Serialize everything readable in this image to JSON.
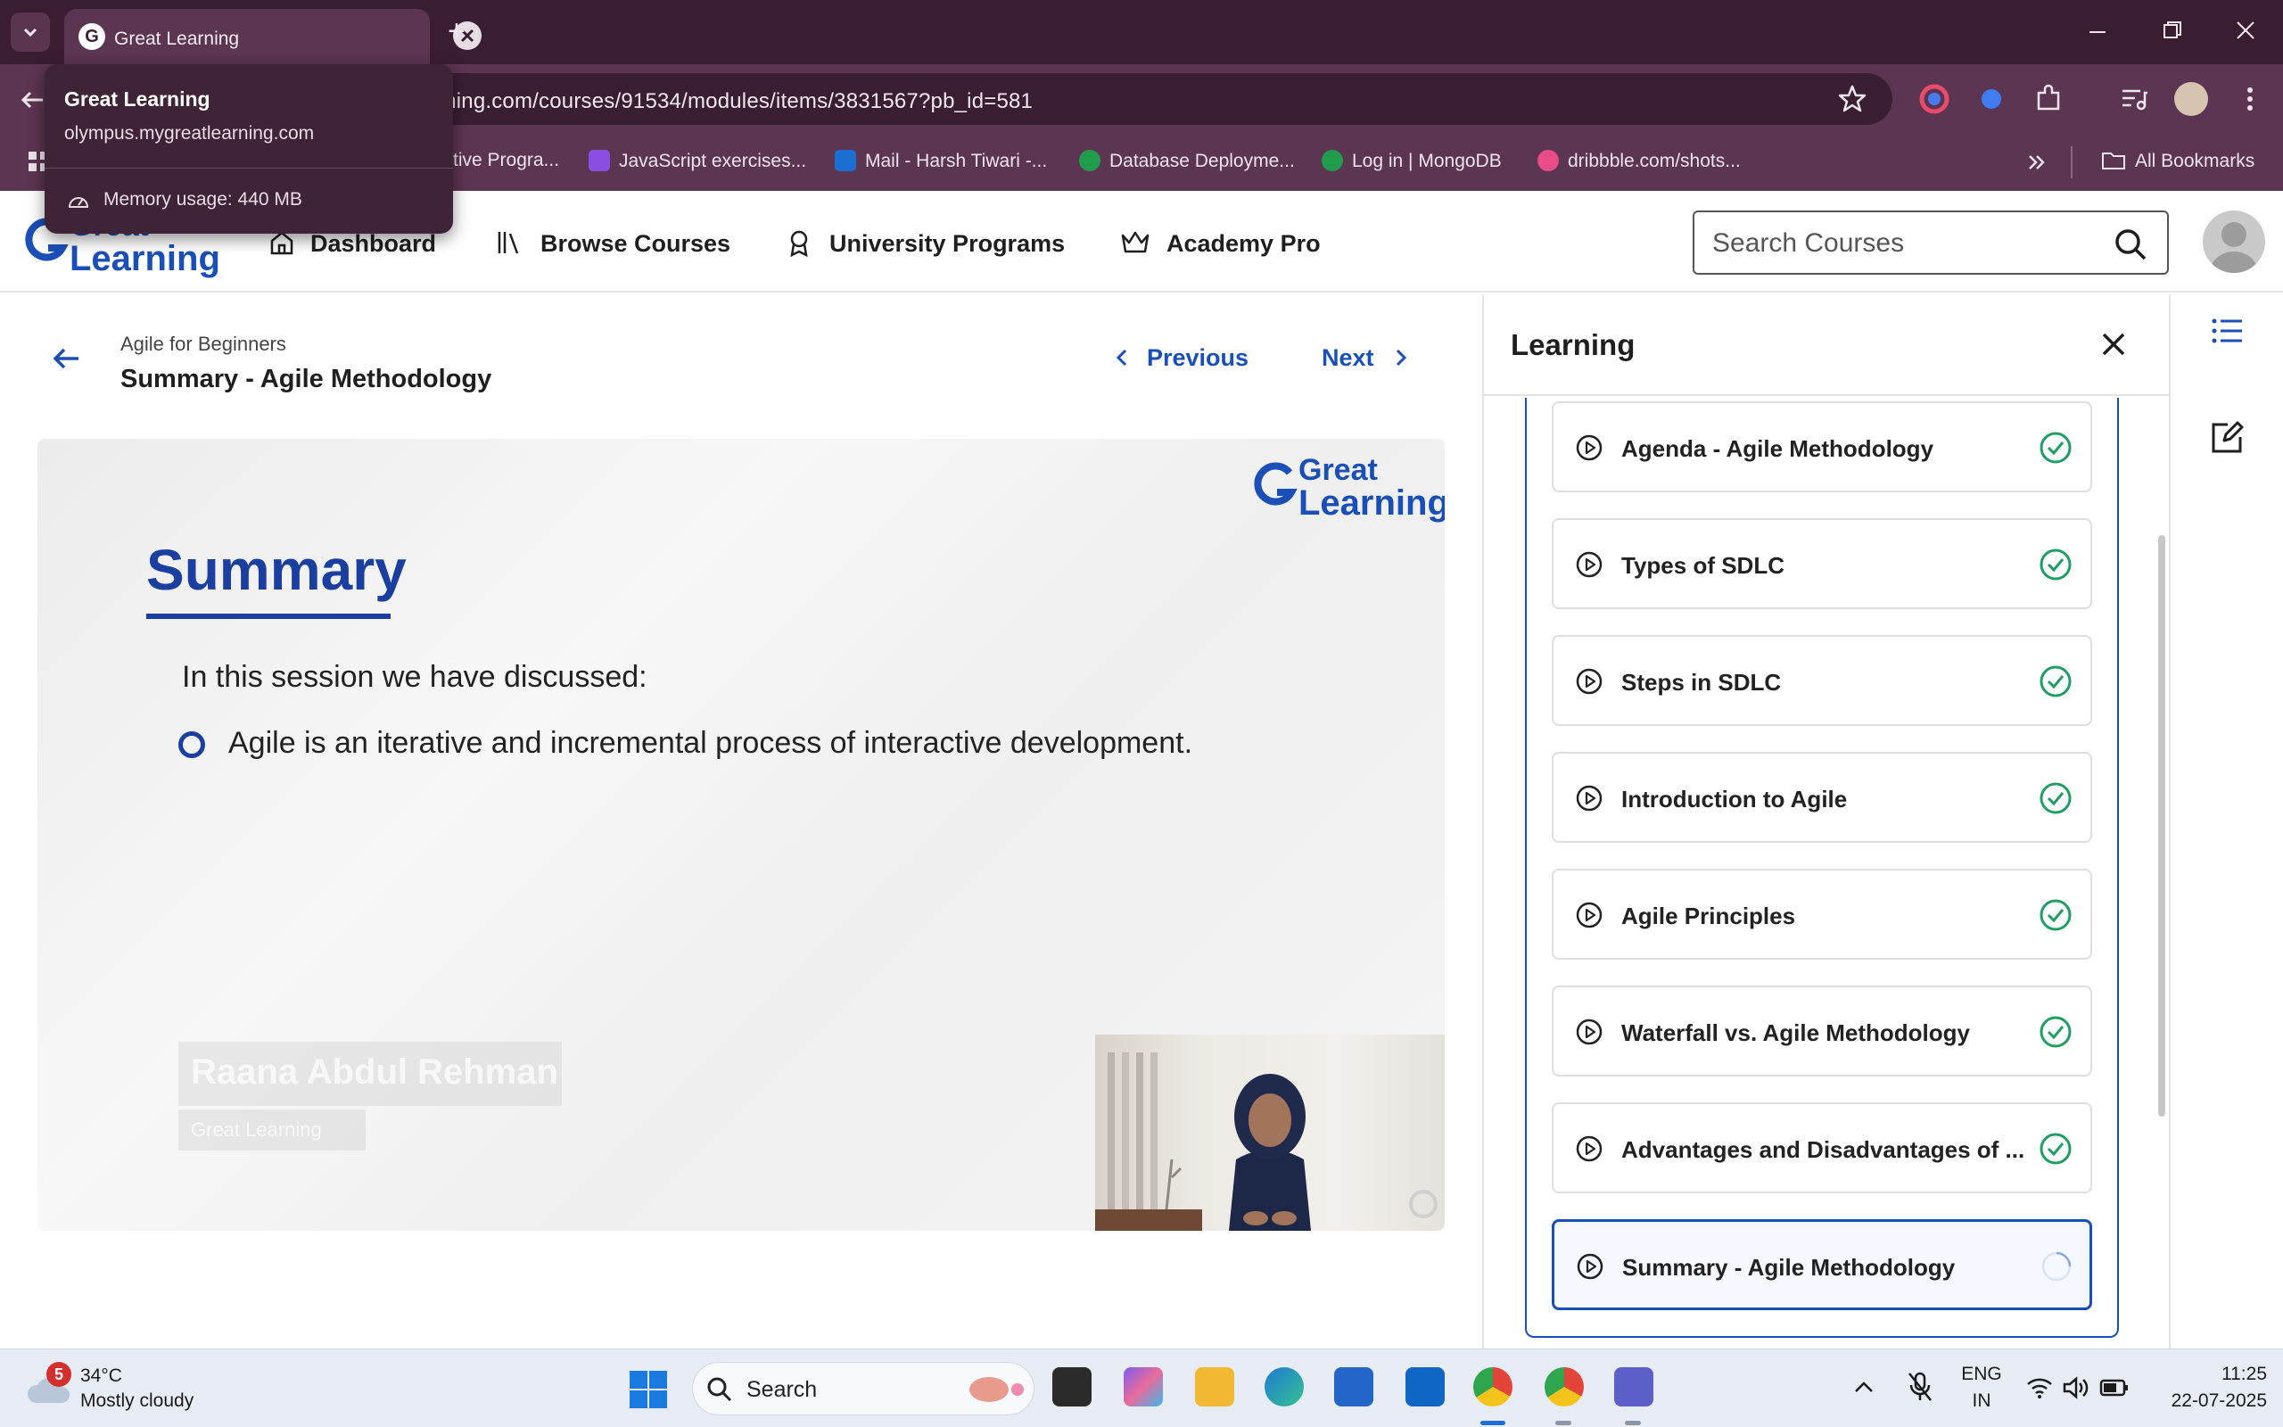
{
  "browser": {
    "tab_title": "Great Learning",
    "url": "rning.com/courses/91534/modules/items/3831567?pb_id=581",
    "hover_card": {
      "title": "Great Learning",
      "domain": "olympus.mygreatlearning.com",
      "memory": "Memory usage: 440 MB"
    },
    "bookmarks": [
      {
        "label": "tive Progra..."
      },
      {
        "label": "JavaScript exercises..."
      },
      {
        "label": "Mail - Harsh Tiwari -..."
      },
      {
        "label": "Database Deployme..."
      },
      {
        "label": "Log in | MongoDB"
      },
      {
        "label": "dribbble.com/shots..."
      }
    ],
    "all_bookmarks": "All Bookmarks"
  },
  "site": {
    "logo_line1": "Great",
    "logo_line2": "Learning",
    "nav": [
      {
        "label": "Dashboard",
        "icon": "home-icon"
      },
      {
        "label": "Browse Courses",
        "icon": "library-icon"
      },
      {
        "label": "University Programs",
        "icon": "award-icon"
      },
      {
        "label": "Academy Pro",
        "icon": "crown-icon"
      }
    ],
    "search_placeholder": "Search Courses"
  },
  "lesson": {
    "course": "Agile for Beginners",
    "title": "Summary - Agile Methodology",
    "prev_label": "Previous",
    "next_label": "Next"
  },
  "video": {
    "slide_title": "Summary",
    "intro": "In this session we have discussed:",
    "points": [
      "Agile is an iterative and incremental process of interactive development."
    ],
    "presenter_name": "Raana Abdul Rehman",
    "presenter_org": "Great Learning"
  },
  "panel": {
    "title": "Learning",
    "items": [
      {
        "label": "Agenda - Agile Methodology",
        "status": "complete"
      },
      {
        "label": "Types of SDLC",
        "status": "complete"
      },
      {
        "label": "Steps in SDLC",
        "status": "complete"
      },
      {
        "label": "Introduction to Agile",
        "status": "complete"
      },
      {
        "label": "Agile Principles",
        "status": "complete"
      },
      {
        "label": "Waterfall vs. Agile Methodology",
        "status": "complete"
      },
      {
        "label": "Advantages and Disadvantages of ...",
        "status": "complete"
      },
      {
        "label": "Summary - Agile Methodology",
        "status": "in-progress"
      }
    ]
  },
  "taskbar": {
    "weather_badge": "5",
    "temperature": "34°C",
    "weather": "Mostly cloudy",
    "search_label": "Search",
    "lang_top": "ENG",
    "lang_bottom": "IN",
    "time": "11:25",
    "date": "22-07-2025"
  },
  "colors": {
    "brand_blue": "#1b4fb8",
    "chrome_dark": "#3b1d32",
    "chrome_mid": "#5c3552",
    "check_green": "#1f9d63"
  }
}
